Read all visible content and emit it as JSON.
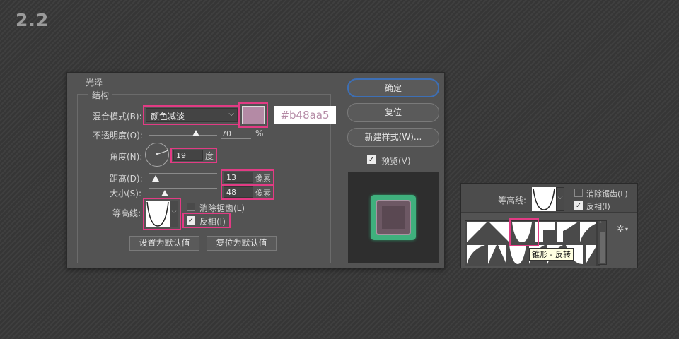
{
  "step_number": "2.2",
  "dialog": {
    "section_title": "光泽",
    "group_title": "结构",
    "blend_mode": {
      "label": "混合模式(B):",
      "value": "颜色减淡",
      "color": "#b48aa5"
    },
    "color_callout": "#b48aa5",
    "opacity": {
      "label": "不透明度(O):",
      "value": "70",
      "unit": "%",
      "level_percent": 70
    },
    "angle": {
      "label": "角度(N):",
      "value": "19",
      "unit": "度"
    },
    "distance": {
      "label": "距离(D):",
      "value": "13",
      "unit": "像素"
    },
    "size": {
      "label": "大小(S):",
      "value": "48",
      "unit": "像素"
    },
    "contour": {
      "label": "等高线:",
      "antialias_label": "消除锯齿(L)",
      "antialias_checked": false,
      "invert_label": "反相(I)",
      "invert_checked": true
    },
    "make_default_label": "设置为默认值",
    "reset_default_label": "复位为默认值",
    "ok_label": "确定",
    "reset_label": "复位",
    "new_style_label": "新建样式(W)...",
    "preview": {
      "label": "预览(V)",
      "checked": true
    }
  },
  "contour_panel": {
    "label": "等高线:",
    "antialias_label": "消除锯齿(L)",
    "antialias_checked": false,
    "invert_label": "反相(I)",
    "invert_checked": true,
    "tooltip": "锥形 - 反转",
    "gear_icon": "gear-icon"
  }
}
